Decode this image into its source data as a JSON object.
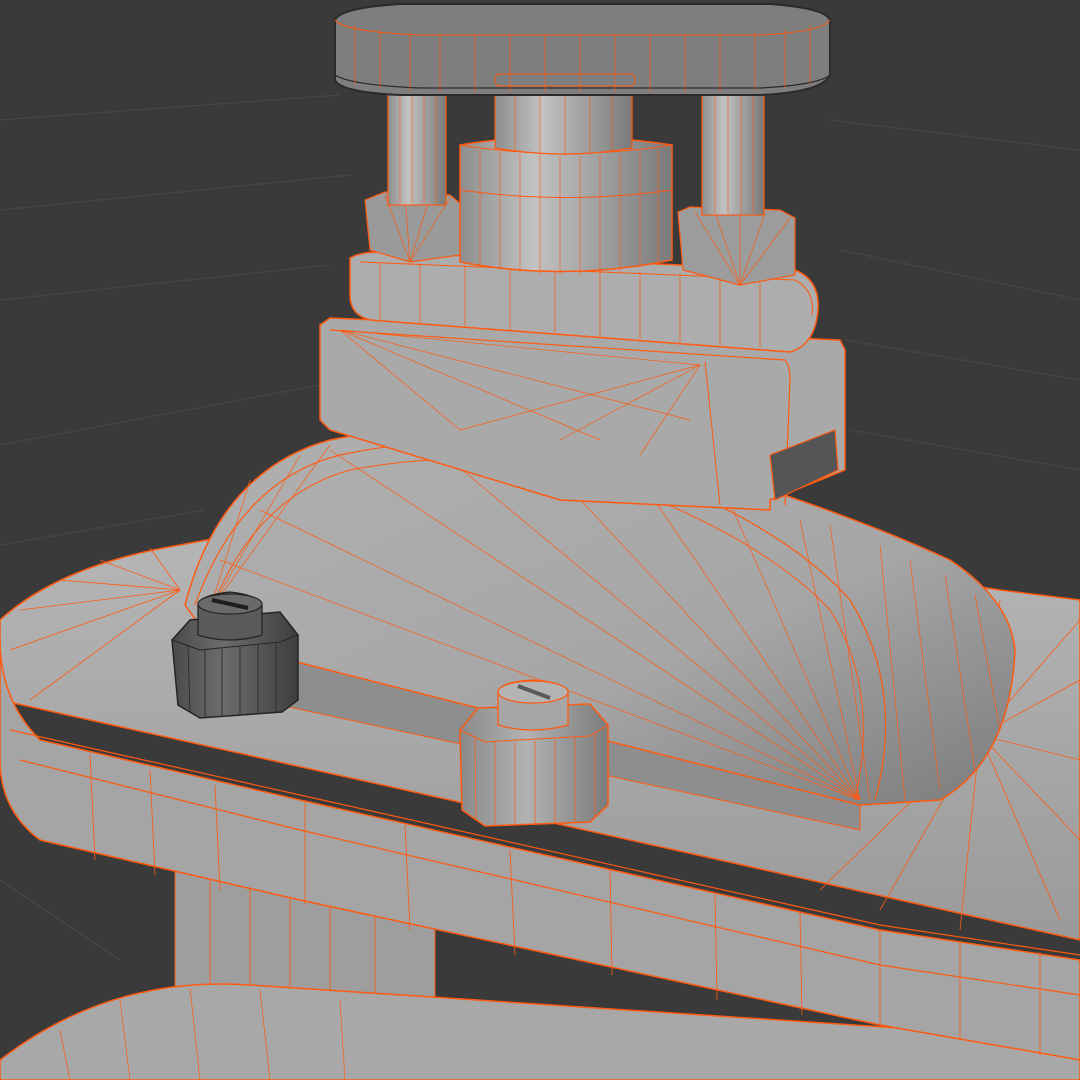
{
  "scene": {
    "colors": {
      "background": "#3a3a3a",
      "grid_line": "#4a4a4a",
      "surface_light": "#b4b4b4",
      "surface_mid": "#a2a2a2",
      "surface_dark": "#8c8c8c",
      "surface_shadow": "#6e6e6e",
      "nut_dark": "#5e5e5e",
      "nut_edge": "#2e2e2e",
      "wire_orange": "#ff5a10"
    },
    "objects": [
      "flanged-valve-body",
      "valve-bonnet",
      "packing-gland",
      "gland-bolt-left",
      "gland-bolt-right",
      "stem-guide-posts",
      "handwheel",
      "hex-nut-left",
      "hex-nut-right"
    ]
  }
}
